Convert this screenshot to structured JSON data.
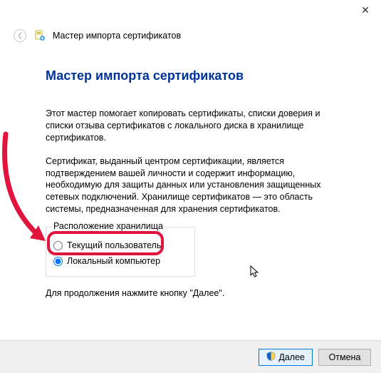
{
  "titlebar": {
    "close": "✕"
  },
  "header": {
    "title": "Мастер импорта сертификатов"
  },
  "page": {
    "title": "Мастер импорта сертификатов",
    "para1": "Этот мастер помогает копировать сертификаты, списки доверия и списки отзыва сертификатов с локального диска в хранилище сертификатов.",
    "para2": "Сертификат, выданный центром сертификации, является подтверждением вашей личности и содержит информацию, необходимую для защиты данных или установления защищенных сетевых подключений. Хранилище сертификатов — это область системы, предназначенная для хранения сертификатов.",
    "group_legend": "Расположение хранилища",
    "radio_current_user": "Текущий пользователь",
    "radio_local_machine": "Локальный компьютер",
    "continue_text": "Для продолжения нажмите кнопку \"Далее\"."
  },
  "footer": {
    "next": "Далее",
    "cancel": "Отмена"
  }
}
